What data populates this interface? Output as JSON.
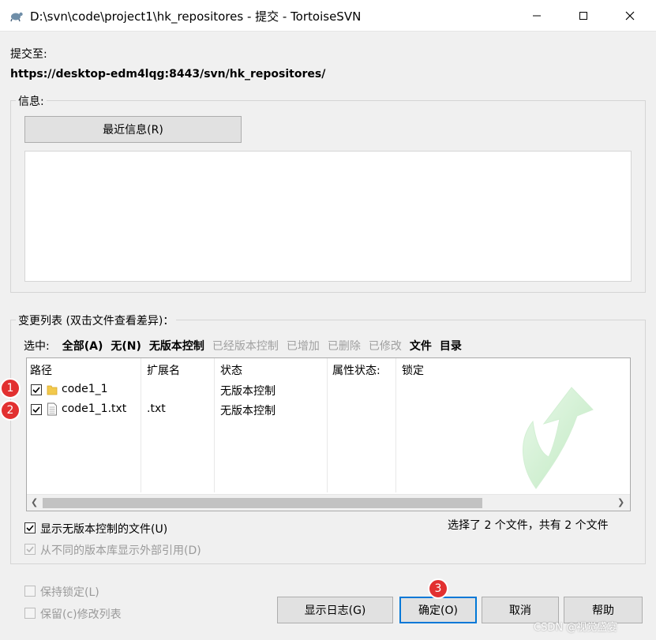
{
  "window": {
    "title": "D:\\svn\\code\\project1\\hk_repositores - 提交 - TortoiseSVN",
    "minimize_icon": "minimize-icon",
    "maximize_icon": "maximize-icon",
    "close_icon": "close-icon"
  },
  "commit_to": {
    "label": "提交至:",
    "url": "https://desktop-edm4lqg:8443/svn/hk_repositores/"
  },
  "message": {
    "group_label": "信息:",
    "recent_button": "最近信息(R)",
    "text": ""
  },
  "changes": {
    "group_label": "变更列表 (双击文件查看差异)：",
    "select_label": "选中:",
    "filters": [
      {
        "label": "全部(A)",
        "style": "bold"
      },
      {
        "label": "无(N)",
        "style": "bold"
      },
      {
        "label": "无版本控制",
        "style": "bold"
      },
      {
        "label": "已经版本控制",
        "style": "dim"
      },
      {
        "label": "已增加",
        "style": "dim"
      },
      {
        "label": "已删除",
        "style": "dim"
      },
      {
        "label": "已修改",
        "style": "dim"
      },
      {
        "label": "文件",
        "style": "bold"
      },
      {
        "label": "目录",
        "style": "bold"
      }
    ],
    "columns": [
      "路径",
      "扩展名",
      "状态",
      "属性状态:",
      "锁定"
    ],
    "rows": [
      {
        "checked": true,
        "icon": "folder-icon",
        "path": "code1_1",
        "ext": "",
        "status": "无版本控制",
        "prop_status": "",
        "lock": ""
      },
      {
        "checked": true,
        "icon": "file-icon",
        "path": "code1_1.txt",
        "ext": ".txt",
        "status": "无版本控制",
        "prop_status": "",
        "lock": ""
      }
    ],
    "selection_summary": "选择了 2 个文件，共有 2 个文件",
    "show_unversioned": {
      "label": "显示无版本控制的文件(U)",
      "checked": true
    },
    "show_externals": {
      "label": "从不同的版本库显示外部引用(D)",
      "checked": true,
      "disabled": true
    }
  },
  "options": {
    "keep_locks": {
      "label": "保持锁定(L)",
      "checked": false
    },
    "keep_changelists": {
      "label": "保留(c)修改列表",
      "checked": false
    }
  },
  "buttons": {
    "show_log": "显示日志(G)",
    "ok": "确定(O)",
    "cancel": "取消",
    "help": "帮助"
  },
  "badges": [
    "1",
    "2",
    "3"
  ],
  "watermark": "CSDN @视觉盛宴",
  "colors": {
    "badge": "#e23030",
    "accent": "#0078d7"
  }
}
